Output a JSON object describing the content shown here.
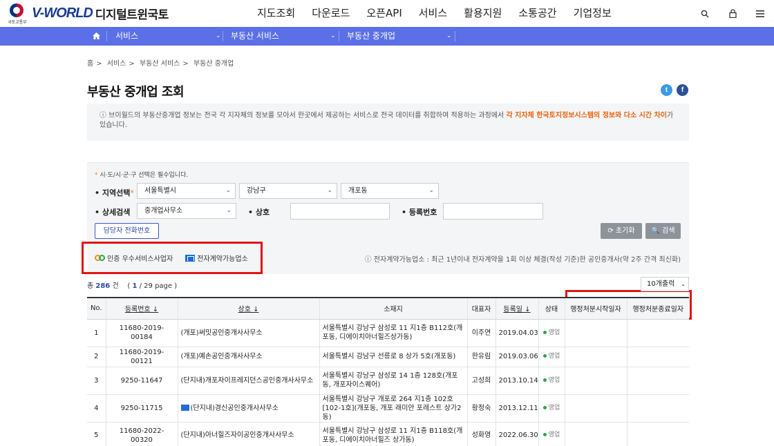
{
  "header": {
    "ministry_name": "국토교통부",
    "logo_text": "V-WORLD",
    "logo_korean": "디지털트윈국토",
    "menu": [
      "지도조회",
      "다운로드",
      "오픈API",
      "서비스",
      "활용지원",
      "소통공간",
      "기업정보"
    ],
    "icons": [
      "search-icon",
      "lock-icon",
      "menu-icon"
    ]
  },
  "subnav": {
    "home_icon": "home-icon",
    "level1": "서비스",
    "level2": "부동산 서비스",
    "level3": "부동산 중개업",
    "accent": "#5b6fe6"
  },
  "breadcrumb": [
    "홈",
    "서비스",
    "부동산 서비스",
    "부동산 중개업"
  ],
  "page": {
    "title": "부동산 중개업 조회",
    "share": [
      "twitter-icon",
      "facebook-icon"
    ]
  },
  "notice": {
    "text_plain": "ⓘ 브이월드의 부동산중개업 정보는 전국 각 지자체의 정보를 모아서 한곳에서 제공하는 서비스로 전국 데이터를 취합하여 적용하는 과정에서",
    "text_highlight": "각 지자체 한국토지정보시스템의 정보와 다소 시간 차이",
    "text_end": "가 있습니다."
  },
  "filter": {
    "required_note": "시·도/시·군·구 선택은 필수입니다.",
    "region_label": "• 지역선택",
    "region_sido": "서울특별시",
    "region_sigungu": "강남구",
    "region_dong": "개포동",
    "detail_label": "• 상세검색",
    "detail_type": "중개업사무소",
    "name_label": "• 상호",
    "reg_label": "• 등록번호",
    "contact_button": "담당자 전화번호",
    "reset_button": "⟳ 초기화",
    "search_button": "🔍 검색",
    "legend_certified": "인증 우수서비스사업자",
    "legend_econtract": "전자계약가능업소",
    "econtract_note": "ⓘ 전자계약가능업소 : 최근 1년이내 전자계약을 1회 이상 체결(작성 기준)한 공인중개사(약 2주 간격 최신화)"
  },
  "results": {
    "total_prefix": "총",
    "total": "286",
    "total_suffix": "건",
    "page_info_open": "(",
    "page_current": "1",
    "page_rest": "/ 29 page )",
    "per_page": "10개출력",
    "columns": [
      "No.",
      "등록번호 ↓",
      "상호 ↓",
      "소재지",
      "대표자",
      "등록일 ↓",
      "상태",
      "행정처분시작일자",
      "행정처분종료일자"
    ],
    "rows": [
      {
        "no": "1",
        "reg": "11680-2019-00184",
        "name": "(개포)써밋공인중개사사무소",
        "addr": "서울특별시 강남구 삼성로 11 지1층 B112호(개포동, 디에이치아너힐즈상가동)",
        "rep": "이주연",
        "date": "2019.04.03",
        "status": "영업",
        "econtract": false
      },
      {
        "no": "2",
        "reg": "11680-2019-00121",
        "name": "(개포)예손공인중개사사무소",
        "addr": "서울특별시 강남구 선릉로 8 상가 5호(개포동)",
        "rep": "한유림",
        "date": "2019.03.06",
        "status": "영업",
        "econtract": false
      },
      {
        "no": "3",
        "reg": "9250-11647",
        "name": "(단지내)개포자이프레지던스공인중개사사무소",
        "addr": "서울특별시 강남구 삼성로 14 1층 128호(개포동, 개포자이스퀘어)",
        "rep": "고성희",
        "date": "2013.10.14",
        "status": "영업",
        "econtract": false
      },
      {
        "no": "4",
        "reg": "9250-11715",
        "name": "(단지내)경신공인중개사사무소",
        "addr": "서울특별시 강남구 개포로 264 지1층 102호[102-1호](개포동, 개포 래미안 포레스트 상가2동)",
        "rep": "황정숙",
        "date": "2013.12.11",
        "status": "영업",
        "econtract": true
      },
      {
        "no": "5",
        "reg": "11680-2022-00320",
        "name": "(단지내)아너힐즈자이공인중개사사무소",
        "addr": "서울특별시 강남구 삼성로 11 지1층 B118호(개포동, 디에이치아너힐즈 상가동)",
        "rep": "성화영",
        "date": "2022.06.30",
        "status": "영업",
        "econtract": false
      }
    ]
  },
  "colors": {
    "brand_blue": "#1b3c8e",
    "highlight_orange": "#e8620c",
    "annotation_red": "#e21212",
    "status_green": "#2aa844"
  }
}
